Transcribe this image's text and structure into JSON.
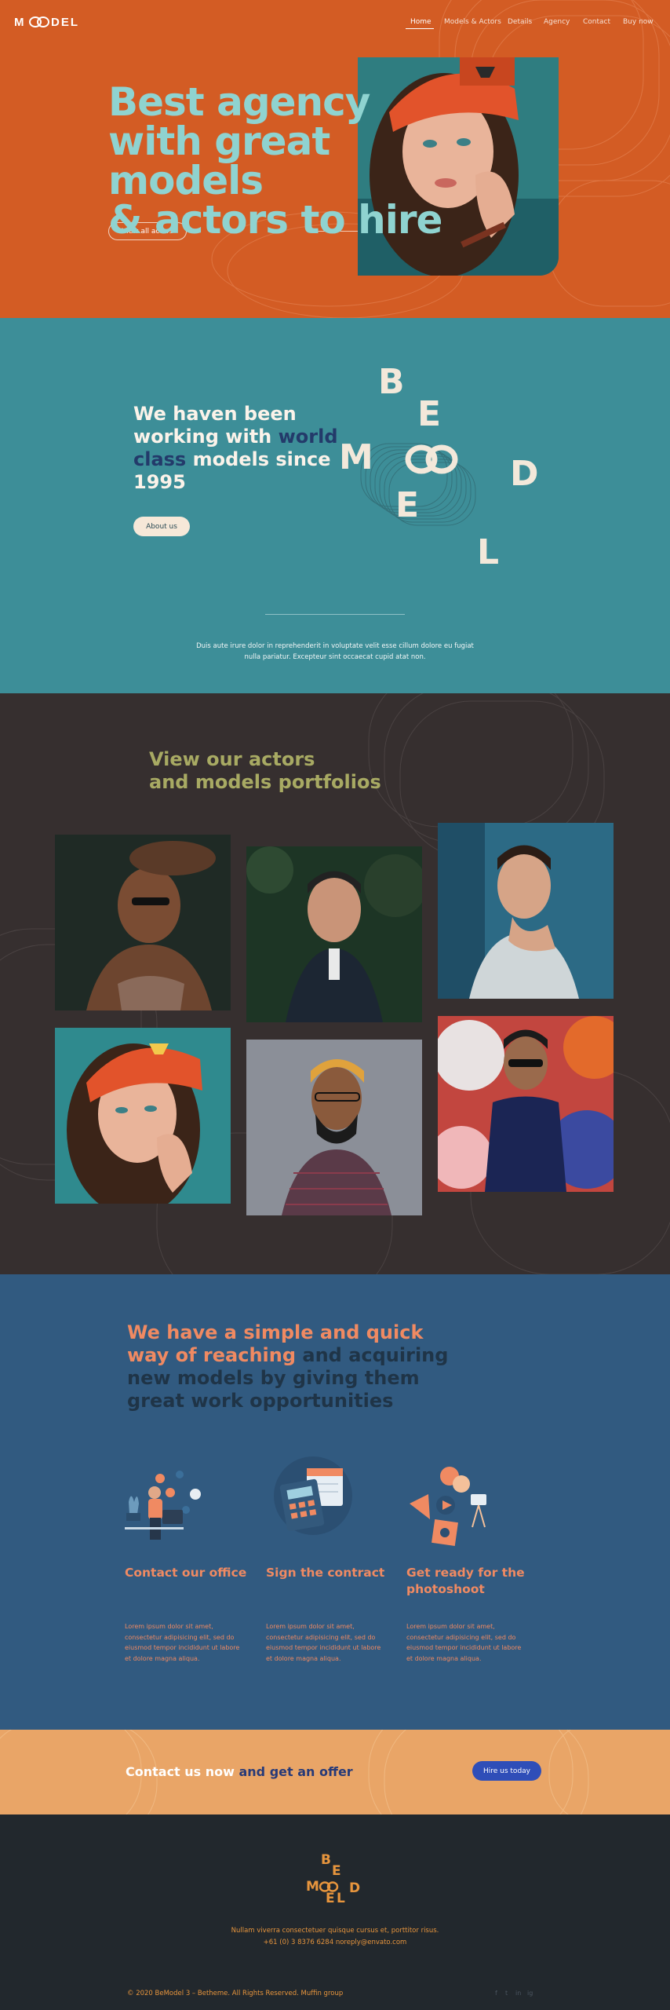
{
  "header": {
    "logo": "MOODEL",
    "nav": [
      "Home",
      "Models & Actors",
      "Details",
      "Agency",
      "Contact",
      "Buy now"
    ],
    "active_nav": "Home"
  },
  "hero": {
    "title_lines": [
      "Best agency",
      "with great models",
      "& actors to hire"
    ],
    "button": "View all actors"
  },
  "about": {
    "title_part1": "We haven been working with ",
    "title_highlight": "world class",
    "title_part2": " models since 1995",
    "button": "About us",
    "logo_letters": [
      "B",
      "E",
      "M",
      "OO",
      "D",
      "E",
      "L"
    ],
    "text": "Duis aute irure dolor in reprehenderit in voluptate velit esse cillum dolore eu fugiat nulla pariatur. Excepteur sint occaecat cupid atat non."
  },
  "portfolio": {
    "title_line1": "View our actors",
    "title_line2": "and models portfolios"
  },
  "process": {
    "title_orange": "We have a simple and quick way of reaching",
    "title_dark": " and acquiring new models by giving them great work opportunities",
    "steps": [
      {
        "title": "Contact our office",
        "text": "Lorem ipsum dolor sit amet, consectetur adipisicing elit, sed do eiusmod tempor incididunt ut labore et dolore magna aliqua."
      },
      {
        "title": "Sign the contract",
        "text": "Lorem ipsum dolor sit amet, consectetur adipisicing elit, sed do eiusmod tempor incididunt ut labore et dolore magna aliqua."
      },
      {
        "title": "Get ready for the photoshoot",
        "text": "Lorem ipsum dolor sit amet, consectetur adipisicing elit, sed do eiusmod tempor incididunt ut labore et dolore magna aliqua."
      }
    ]
  },
  "cta": {
    "text_white": "Contact us now",
    "text_navy": " and get an offer",
    "button": "Hire us today"
  },
  "footer": {
    "address_line1": "Nullam viverra consectetuer quisque cursus et, porttitor risus.",
    "address_line2": "+61 (0) 3 8376 6284 noreply@envato.com",
    "copyright": "© 2020 BeModel 3 – Betheme. All Rights Reserved. Muffin group",
    "social": [
      "f",
      "t",
      "in",
      "ig"
    ]
  },
  "colors": {
    "hero_bg": "#d35c24",
    "hero_title": "#8fd3d0",
    "about_bg": "#3d8e98",
    "portfolio_bg": "#362f2f",
    "portfolio_title": "#a8aa63",
    "process_bg": "#315a80",
    "accent_orange": "#f08a62",
    "cta_bg": "#e9a567",
    "cta_button": "#2f4eb8",
    "footer_bg": "#22282d"
  }
}
